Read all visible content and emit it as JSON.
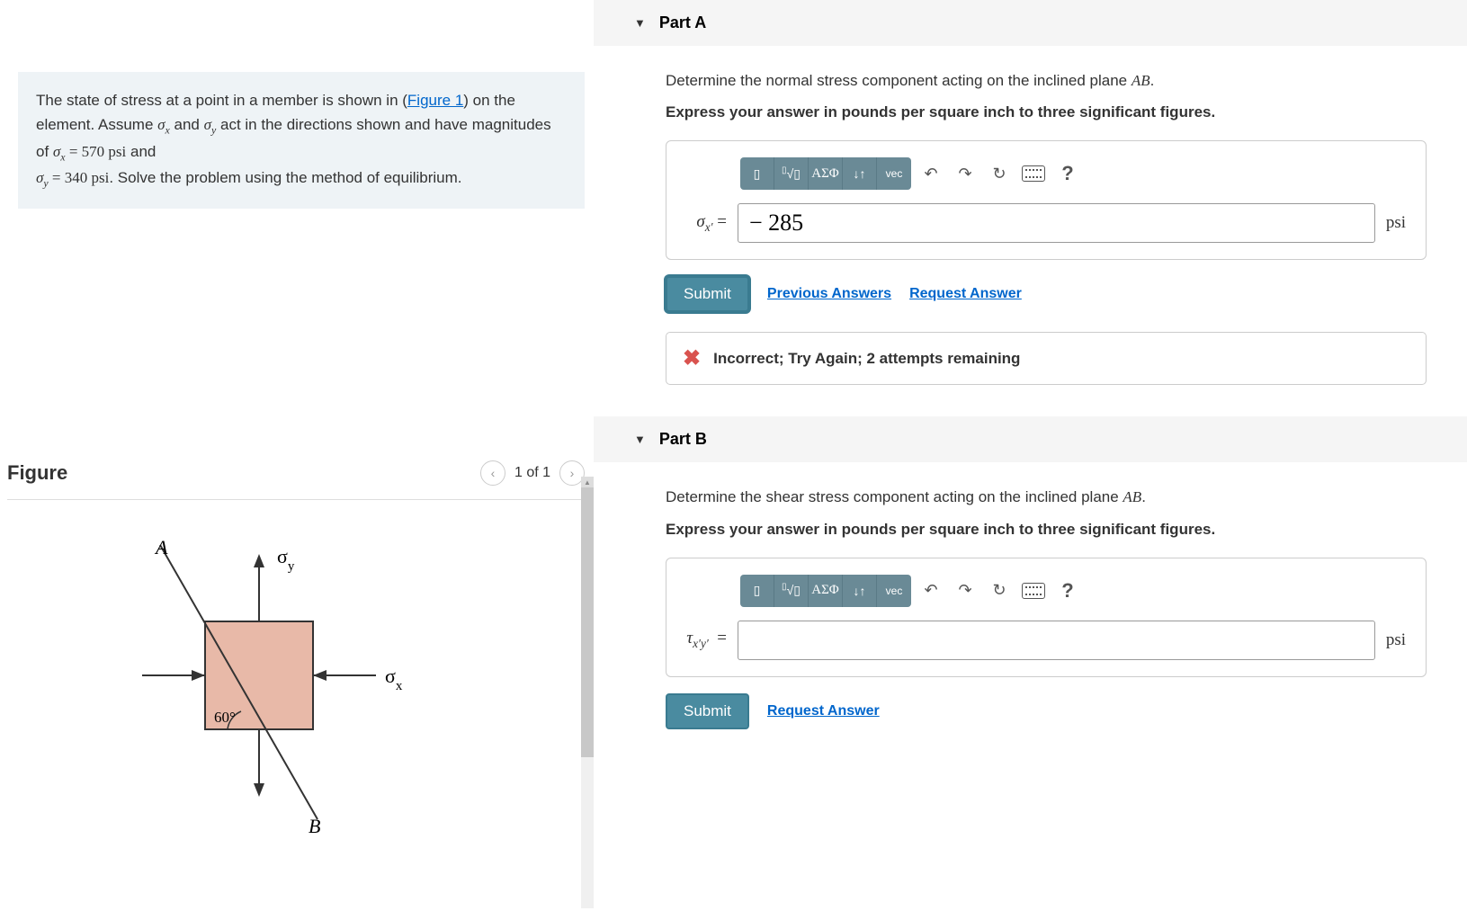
{
  "problem": {
    "text_line1_prefix": "The state of stress at a point in a member is shown in (",
    "figure_link": "Figure 1",
    "text_line1_suffix": ") on the",
    "text_line2": "element. Assume ",
    "sigma_x": "σ",
    "sub_x": "x",
    "and_text": " and ",
    "sigma_y": "σ",
    "sub_y": "y",
    "text_line2_suffix": " act in the directions shown and have magnitudes",
    "text_line3_prefix": "of ",
    "eq1": "σ",
    "eq1_sub": "x",
    "eq1_val": " = 570 psi",
    "and2": " and",
    "eq2": "σ",
    "eq2_sub": "y",
    "eq2_val": " = 340 psi",
    "text_line4": ". Solve the problem using the method of equilibrium."
  },
  "figure": {
    "title": "Figure",
    "counter": "1 of 1",
    "labels": {
      "A": "A",
      "B": "B",
      "sigma_x": "σ",
      "sigma_x_sub": "x",
      "sigma_y": "σ",
      "sigma_y_sub": "y",
      "angle": "60°"
    }
  },
  "partA": {
    "title": "Part A",
    "instruction1_prefix": "Determine the normal stress component acting on the inclined plane ",
    "instruction1_var": "AB",
    "instruction1_suffix": ".",
    "instruction2": "Express your answer in pounds per square inch to three significant figures.",
    "var_label_html": "σ<sub style='font-style:italic'>x′</sub> =",
    "var_label": "σx' =",
    "input_value": "− 285",
    "unit": "psi",
    "submit": "Submit",
    "prev_answers": "Previous Answers",
    "request_answer": "Request Answer",
    "feedback": "Incorrect; Try Again; 2 attempts remaining"
  },
  "partB": {
    "title": "Part B",
    "instruction1_prefix": "Determine the shear stress component acting on the inclined plane ",
    "instruction1_var": "AB",
    "instruction1_suffix": ".",
    "instruction2": "Express your answer in pounds per square inch to three significant figures.",
    "var_label": "τx'y'  =",
    "input_value": "",
    "unit": "psi",
    "submit": "Submit",
    "request_answer": "Request Answer"
  },
  "toolbar": {
    "templates": "▯",
    "root": "√▯",
    "greek": "ΑΣΦ",
    "updown": "↓↑",
    "vec": "vec",
    "undo": "↶",
    "redo": "↷",
    "reset": "↻",
    "help": "?"
  }
}
